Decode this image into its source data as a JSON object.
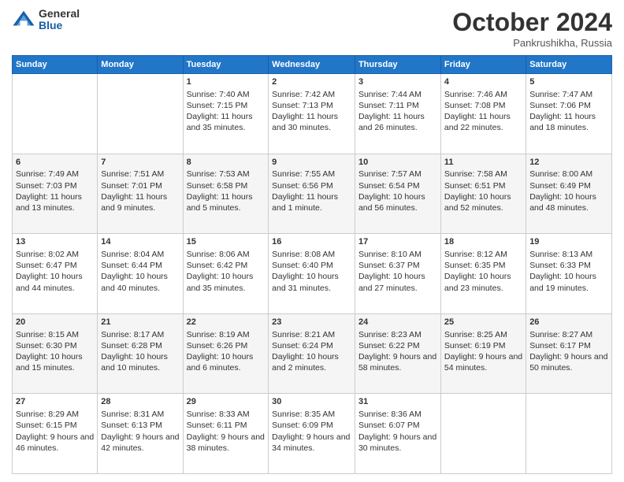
{
  "logo": {
    "general": "General",
    "blue": "Blue"
  },
  "header": {
    "month": "October 2024",
    "location": "Pankrushikha, Russia"
  },
  "weekdays": [
    "Sunday",
    "Monday",
    "Tuesday",
    "Wednesday",
    "Thursday",
    "Friday",
    "Saturday"
  ],
  "weeks": [
    [
      {
        "day": "",
        "info": ""
      },
      {
        "day": "",
        "info": ""
      },
      {
        "day": "1",
        "info": "Sunrise: 7:40 AM\nSunset: 7:15 PM\nDaylight: 11 hours and 35 minutes."
      },
      {
        "day": "2",
        "info": "Sunrise: 7:42 AM\nSunset: 7:13 PM\nDaylight: 11 hours and 30 minutes."
      },
      {
        "day": "3",
        "info": "Sunrise: 7:44 AM\nSunset: 7:11 PM\nDaylight: 11 hours and 26 minutes."
      },
      {
        "day": "4",
        "info": "Sunrise: 7:46 AM\nSunset: 7:08 PM\nDaylight: 11 hours and 22 minutes."
      },
      {
        "day": "5",
        "info": "Sunrise: 7:47 AM\nSunset: 7:06 PM\nDaylight: 11 hours and 18 minutes."
      }
    ],
    [
      {
        "day": "6",
        "info": "Sunrise: 7:49 AM\nSunset: 7:03 PM\nDaylight: 11 hours and 13 minutes."
      },
      {
        "day": "7",
        "info": "Sunrise: 7:51 AM\nSunset: 7:01 PM\nDaylight: 11 hours and 9 minutes."
      },
      {
        "day": "8",
        "info": "Sunrise: 7:53 AM\nSunset: 6:58 PM\nDaylight: 11 hours and 5 minutes."
      },
      {
        "day": "9",
        "info": "Sunrise: 7:55 AM\nSunset: 6:56 PM\nDaylight: 11 hours and 1 minute."
      },
      {
        "day": "10",
        "info": "Sunrise: 7:57 AM\nSunset: 6:54 PM\nDaylight: 10 hours and 56 minutes."
      },
      {
        "day": "11",
        "info": "Sunrise: 7:58 AM\nSunset: 6:51 PM\nDaylight: 10 hours and 52 minutes."
      },
      {
        "day": "12",
        "info": "Sunrise: 8:00 AM\nSunset: 6:49 PM\nDaylight: 10 hours and 48 minutes."
      }
    ],
    [
      {
        "day": "13",
        "info": "Sunrise: 8:02 AM\nSunset: 6:47 PM\nDaylight: 10 hours and 44 minutes."
      },
      {
        "day": "14",
        "info": "Sunrise: 8:04 AM\nSunset: 6:44 PM\nDaylight: 10 hours and 40 minutes."
      },
      {
        "day": "15",
        "info": "Sunrise: 8:06 AM\nSunset: 6:42 PM\nDaylight: 10 hours and 35 minutes."
      },
      {
        "day": "16",
        "info": "Sunrise: 8:08 AM\nSunset: 6:40 PM\nDaylight: 10 hours and 31 minutes."
      },
      {
        "day": "17",
        "info": "Sunrise: 8:10 AM\nSunset: 6:37 PM\nDaylight: 10 hours and 27 minutes."
      },
      {
        "day": "18",
        "info": "Sunrise: 8:12 AM\nSunset: 6:35 PM\nDaylight: 10 hours and 23 minutes."
      },
      {
        "day": "19",
        "info": "Sunrise: 8:13 AM\nSunset: 6:33 PM\nDaylight: 10 hours and 19 minutes."
      }
    ],
    [
      {
        "day": "20",
        "info": "Sunrise: 8:15 AM\nSunset: 6:30 PM\nDaylight: 10 hours and 15 minutes."
      },
      {
        "day": "21",
        "info": "Sunrise: 8:17 AM\nSunset: 6:28 PM\nDaylight: 10 hours and 10 minutes."
      },
      {
        "day": "22",
        "info": "Sunrise: 8:19 AM\nSunset: 6:26 PM\nDaylight: 10 hours and 6 minutes."
      },
      {
        "day": "23",
        "info": "Sunrise: 8:21 AM\nSunset: 6:24 PM\nDaylight: 10 hours and 2 minutes."
      },
      {
        "day": "24",
        "info": "Sunrise: 8:23 AM\nSunset: 6:22 PM\nDaylight: 9 hours and 58 minutes."
      },
      {
        "day": "25",
        "info": "Sunrise: 8:25 AM\nSunset: 6:19 PM\nDaylight: 9 hours and 54 minutes."
      },
      {
        "day": "26",
        "info": "Sunrise: 8:27 AM\nSunset: 6:17 PM\nDaylight: 9 hours and 50 minutes."
      }
    ],
    [
      {
        "day": "27",
        "info": "Sunrise: 8:29 AM\nSunset: 6:15 PM\nDaylight: 9 hours and 46 minutes."
      },
      {
        "day": "28",
        "info": "Sunrise: 8:31 AM\nSunset: 6:13 PM\nDaylight: 9 hours and 42 minutes."
      },
      {
        "day": "29",
        "info": "Sunrise: 8:33 AM\nSunset: 6:11 PM\nDaylight: 9 hours and 38 minutes."
      },
      {
        "day": "30",
        "info": "Sunrise: 8:35 AM\nSunset: 6:09 PM\nDaylight: 9 hours and 34 minutes."
      },
      {
        "day": "31",
        "info": "Sunrise: 8:36 AM\nSunset: 6:07 PM\nDaylight: 9 hours and 30 minutes."
      },
      {
        "day": "",
        "info": ""
      },
      {
        "day": "",
        "info": ""
      }
    ]
  ]
}
